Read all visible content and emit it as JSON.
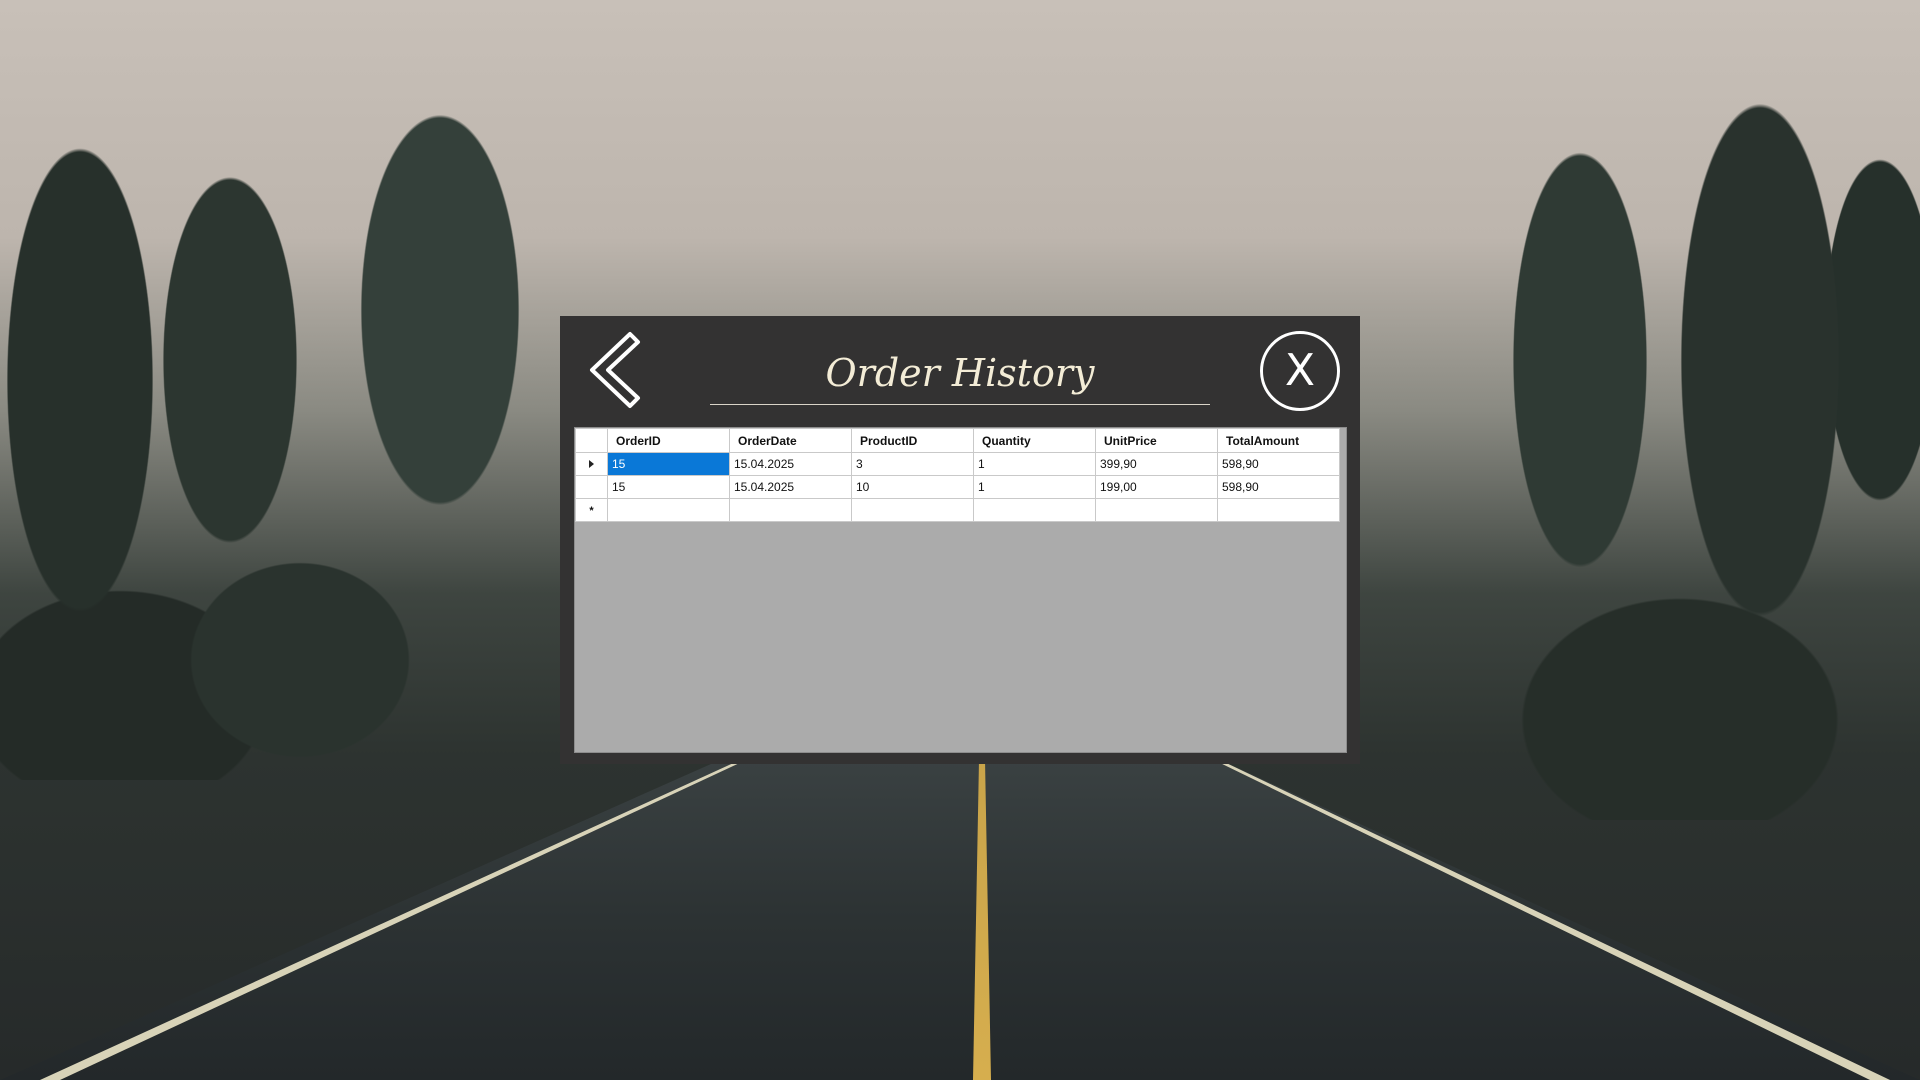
{
  "dialog": {
    "title": "Order History",
    "close_label": "X"
  },
  "grid": {
    "columns": [
      "OrderID",
      "OrderDate",
      "ProductID",
      "Quantity",
      "UnitPrice",
      "TotalAmount"
    ],
    "rows": [
      [
        "15",
        "15.04.2025",
        "3",
        "1",
        "399,90",
        "598,90"
      ],
      [
        "15",
        "15.04.2025",
        "10",
        "1",
        "199,00",
        "598,90"
      ]
    ],
    "new_row_marker": "*",
    "selected_cell": {
      "row": 0,
      "column": "OrderID"
    }
  },
  "colors": {
    "dialog_bg": "#333232",
    "title_text": "#f3ecd6",
    "selection": "#0a78d7",
    "grid_background": "#ababab"
  },
  "icons": {
    "back": "chevron-left-icon",
    "close": "close-icon"
  }
}
